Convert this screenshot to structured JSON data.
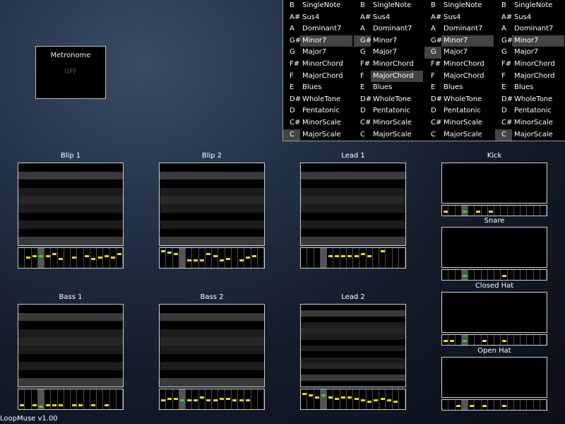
{
  "app": {
    "version_label": "LoopMuse v1.00"
  },
  "metronome": {
    "title": "Metronome",
    "state": "OFF"
  },
  "selector": {
    "roots": [
      "B",
      "A#",
      "A",
      "G#",
      "G",
      "F#",
      "F",
      "E",
      "D#",
      "D",
      "C#",
      "C"
    ],
    "names": [
      "SingleNote",
      "Sus4",
      "Dominant7",
      "Minor7",
      "Major7",
      "MinorChord",
      "MajorChord",
      "Blues",
      "WholeTone",
      "Pentatonic",
      "MinorScale",
      "MajorScale"
    ],
    "columns": [
      {
        "root_on": 11,
        "name_on": 3
      },
      {
        "root_on": 3,
        "name_on": 6
      },
      {
        "root_on": 4,
        "name_on": 3
      },
      {
        "root_on": 11,
        "name_on": 3
      }
    ]
  },
  "instruments": [
    {
      "label": "Blip 1",
      "notes": [
        [
          1,
          4
        ],
        [
          2,
          3
        ],
        [
          3,
          3
        ],
        [
          4,
          3
        ],
        [
          5,
          2
        ],
        [
          6,
          5
        ],
        [
          8,
          4
        ],
        [
          10,
          3
        ],
        [
          11,
          5
        ],
        [
          12,
          4
        ],
        [
          13,
          3
        ],
        [
          14,
          4
        ],
        [
          15,
          2
        ]
      ]
    },
    {
      "label": "Blip 2",
      "notes": [
        [
          0,
          0
        ],
        [
          1,
          1
        ],
        [
          2,
          2
        ],
        [
          4,
          6
        ],
        [
          5,
          6
        ],
        [
          6,
          6
        ],
        [
          7,
          2
        ],
        [
          8,
          3
        ],
        [
          9,
          6
        ],
        [
          10,
          5
        ],
        [
          12,
          6
        ],
        [
          13,
          4
        ],
        [
          14,
          3
        ]
      ]
    },
    {
      "label": "Lead 1",
      "notes": [
        [
          4,
          3
        ],
        [
          5,
          3
        ],
        [
          6,
          3
        ],
        [
          7,
          3
        ],
        [
          8,
          3
        ],
        [
          9,
          2
        ],
        [
          10,
          3
        ],
        [
          12,
          0
        ]
      ]
    },
    {
      "label": "Bass 1",
      "notes": [
        [
          0,
          8
        ],
        [
          2,
          8
        ],
        [
          3,
          9
        ],
        [
          4,
          8
        ],
        [
          5,
          8
        ],
        [
          6,
          8
        ],
        [
          8,
          8
        ],
        [
          9,
          8
        ],
        [
          11,
          8
        ],
        [
          13,
          8
        ]
      ]
    },
    {
      "label": "Bass 2",
      "notes": [
        [
          0,
          5
        ],
        [
          1,
          4
        ],
        [
          2,
          4
        ],
        [
          3,
          5
        ],
        [
          4,
          5
        ],
        [
          5,
          5
        ],
        [
          6,
          3
        ],
        [
          7,
          5
        ],
        [
          8,
          5
        ],
        [
          9,
          4
        ],
        [
          10,
          4
        ],
        [
          11,
          5
        ],
        [
          12,
          5
        ],
        [
          13,
          5
        ]
      ]
    },
    {
      "label": "Lead 2",
      "notes": [
        [
          0,
          1
        ],
        [
          1,
          2
        ],
        [
          2,
          3
        ],
        [
          3,
          2
        ],
        [
          4,
          3
        ],
        [
          5,
          4
        ],
        [
          6,
          3
        ],
        [
          7,
          3
        ],
        [
          8,
          4
        ],
        [
          9,
          5
        ],
        [
          10,
          6
        ],
        [
          11,
          5
        ],
        [
          12,
          4
        ],
        [
          13,
          5
        ],
        [
          14,
          6
        ]
      ]
    },
    {
      "label": "Kick",
      "notes": [
        [
          0,
          1
        ],
        [
          3,
          1
        ],
        [
          5,
          1
        ],
        [
          7,
          1
        ]
      ]
    },
    {
      "label": "Snare",
      "notes": [
        [
          3,
          1
        ],
        [
          9,
          1
        ]
      ]
    },
    {
      "label": "Closed Hat",
      "notes": [
        [
          0,
          1
        ],
        [
          1,
          1
        ],
        [
          3,
          1
        ],
        [
          6,
          1
        ],
        [
          9,
          1
        ]
      ]
    },
    {
      "label": "Open Hat",
      "notes": [
        [
          2,
          1
        ],
        [
          4,
          1
        ],
        [
          6,
          1
        ],
        [
          9,
          1
        ]
      ]
    }
  ]
}
